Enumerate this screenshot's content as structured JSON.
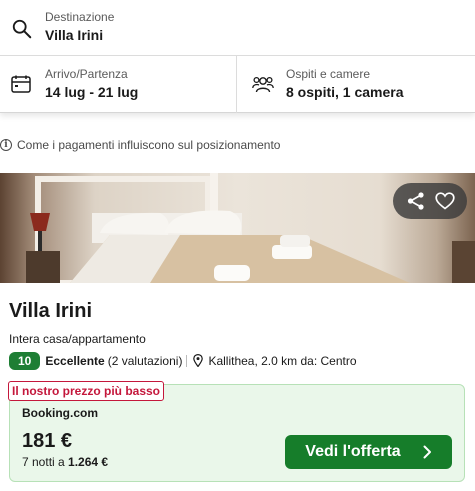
{
  "search": {
    "destination_label": "Destinazione",
    "destination_value": "Villa Irini",
    "dates_label": "Arrivo/Partenza",
    "dates_value": "14 lug - 21 lug",
    "guests_label": "Ospiti e camere",
    "guests_value": "8 ospiti, 1 camera"
  },
  "info": {
    "icon": "info-icon",
    "text": "Come i pagamenti influiscono sul posizionamento"
  },
  "hotel": {
    "name": "Villa Irini",
    "type": "Intera casa/appartamento",
    "rating_score": "10",
    "rating_label": "Eccellente",
    "rating_count": "(2 valutazioni)",
    "location": "Kallithea, 2.0 km da: Centro",
    "photo_alt": "bedroom-photo"
  },
  "deal": {
    "tag": "Il nostro prezzo più basso",
    "provider": "Booking.com",
    "price": "181 €",
    "nights_prefix": "7 notti a",
    "nights_total": "1.264 €",
    "cta_label": "Vedi l'offerta"
  },
  "colors": {
    "rating_green": "#1e7e34",
    "cta_green": "#167d2a",
    "tag_red": "#c4173b",
    "deal_bg": "#eaf7ea"
  }
}
